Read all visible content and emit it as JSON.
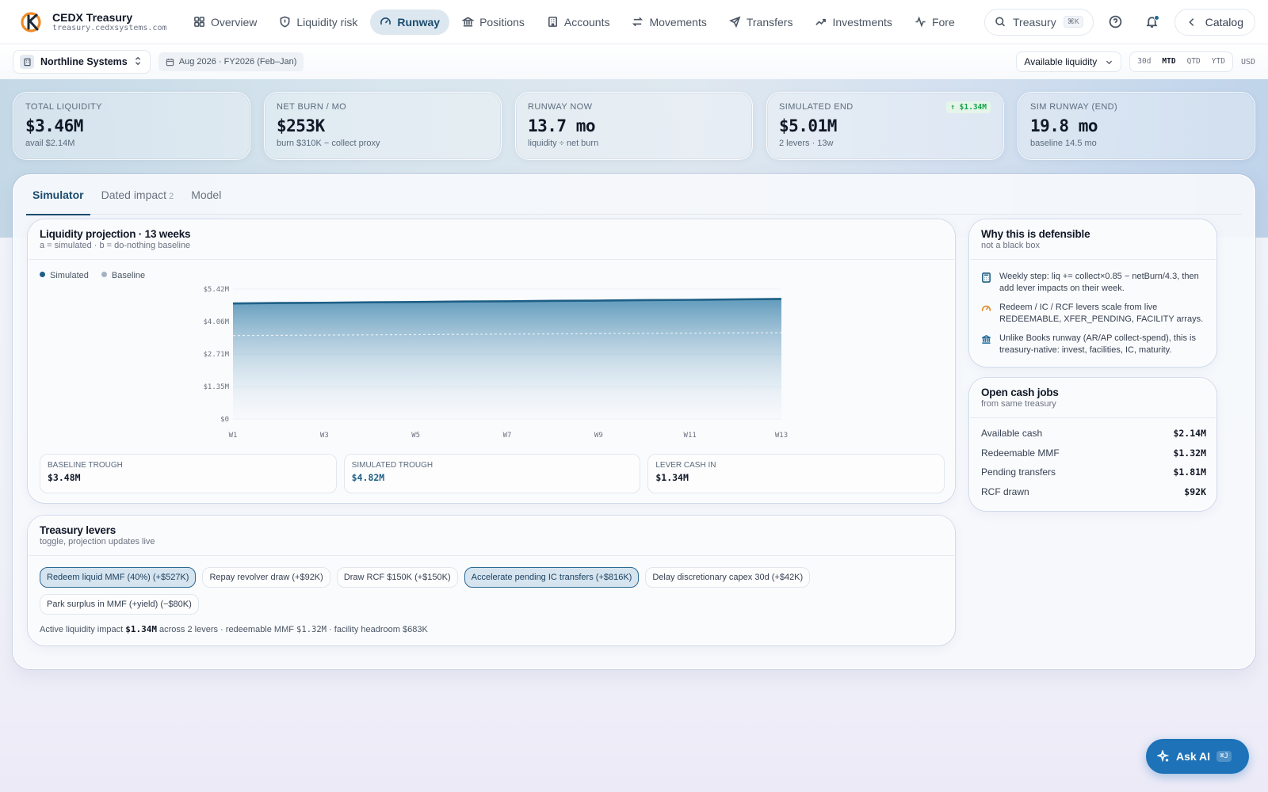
{
  "brand": {
    "title": "CEDX Treasury",
    "domain": "treasury.cedxsystems.com"
  },
  "nav": [
    {
      "label": "Overview",
      "icon": "grid-icon"
    },
    {
      "label": "Liquidity risk",
      "icon": "shield-icon"
    },
    {
      "label": "Runway",
      "icon": "gauge-icon",
      "active": true
    },
    {
      "label": "Positions",
      "icon": "bank-icon"
    },
    {
      "label": "Accounts",
      "icon": "building-icon"
    },
    {
      "label": "Movements",
      "icon": "arrows-icon"
    },
    {
      "label": "Transfers",
      "icon": "send-icon"
    },
    {
      "label": "Investments",
      "icon": "trend-icon"
    },
    {
      "label": "Fore",
      "icon": "pulse-icon"
    }
  ],
  "search": {
    "label": "Treasury",
    "shortcut": "⌘K"
  },
  "catalog_label": "Catalog",
  "subbar": {
    "org": "Northline Systems",
    "period": "Aug 2026 · FY2026 (Feb–Jan)",
    "liquidity_select": "Available liquidity",
    "ranges": [
      "30d",
      "MTD",
      "QTD",
      "YTD"
    ],
    "active_range": "MTD",
    "currency": "USD"
  },
  "kpis": [
    {
      "label": "Total liquidity",
      "value": "$3.46M",
      "sub": "avail $2.14M"
    },
    {
      "label": "Net burn / mo",
      "value": "$253K",
      "sub": "burn $310K − collect proxy"
    },
    {
      "label": "Runway now",
      "value": "13.7 mo",
      "sub": "liquidity ÷ net burn"
    },
    {
      "label": "Simulated end",
      "value": "$5.01M",
      "sub": "2 levers · 13w",
      "badge": "↑ $1.34M"
    },
    {
      "label": "Sim runway (end)",
      "value": "19.8 mo",
      "sub": "baseline 14.5 mo"
    }
  ],
  "tabs": [
    {
      "label": "Simulator",
      "active": true
    },
    {
      "label": "Dated impact",
      "count": "2"
    },
    {
      "label": "Model"
    }
  ],
  "projection": {
    "title": "Liquidity projection · 13 weeks",
    "subtitle": "a = simulated · b = do-nothing baseline",
    "legend": [
      "Simulated",
      "Baseline"
    ],
    "stats": [
      {
        "label": "Baseline trough",
        "value": "$3.48M"
      },
      {
        "label": "Simulated trough",
        "value": "$4.82M"
      },
      {
        "label": "Lever cash in",
        "value": "$1.34M"
      }
    ]
  },
  "chart_data": {
    "type": "area",
    "title": "Liquidity projection · 13 weeks",
    "x": [
      "W1",
      "W2",
      "W3",
      "W4",
      "W5",
      "W6",
      "W7",
      "W8",
      "W9",
      "W10",
      "W11",
      "W12",
      "W13"
    ],
    "x_tick_labels": [
      "W1",
      "W3",
      "W5",
      "W7",
      "W9",
      "W11",
      "W13"
    ],
    "y_ticks": [
      0,
      1.35,
      2.71,
      4.06,
      5.42
    ],
    "y_tick_labels": [
      "$0",
      "$1.35M",
      "$2.71M",
      "$4.06M",
      "$5.42M"
    ],
    "ylim": [
      0,
      5.42
    ],
    "series": [
      {
        "name": "Simulated",
        "values": [
          4.82,
          4.84,
          4.85,
          4.87,
          4.88,
          4.9,
          4.91,
          4.93,
          4.94,
          4.96,
          4.97,
          4.99,
          5.01
        ],
        "color": "#1e5f86"
      },
      {
        "name": "Baseline",
        "values": [
          3.48,
          3.49,
          3.5,
          3.51,
          3.52,
          3.53,
          3.54,
          3.55,
          3.56,
          3.57,
          3.58,
          3.59,
          3.6
        ],
        "color": "#c8d3de"
      }
    ],
    "grid": true,
    "legend": "top-left"
  },
  "levers": {
    "title": "Treasury levers",
    "subtitle": "toggle, projection updates live",
    "items": [
      {
        "label": "Redeem liquid MMF (40%) (+$527K)",
        "on": true
      },
      {
        "label": "Repay revolver draw (+$92K)",
        "on": false
      },
      {
        "label": "Draw RCF $150K (+$150K)",
        "on": false
      },
      {
        "label": "Accelerate pending IC transfers (+$816K)",
        "on": true
      },
      {
        "label": "Delay discretionary capex 30d (+$42K)",
        "on": false
      },
      {
        "label": "Park surplus in MMF (+yield) (−$80K)",
        "on": false
      }
    ],
    "footer": {
      "prefix": "Active liquidity impact",
      "impact": "$1.34M",
      "mid": "across 2 levers · redeemable MMF",
      "mmf": "$1.32M",
      "suffix": "· facility headroom $683K"
    }
  },
  "why": {
    "title": "Why this is defensible",
    "subtitle": "not a black box",
    "items": [
      {
        "text": "Weekly step: liq += collect×0.85 − netBurn/4.3, then add lever impacts on their week.",
        "icon": "calculator-icon",
        "color": "#1e5f86"
      },
      {
        "text": "Redeem / IC / RCF levers scale from live REDEEMABLE, XFER_PENDING, FACILITY arrays.",
        "icon": "gauge-icon",
        "color": "#e08a2a"
      },
      {
        "text": "Unlike Books runway (AR/AP collect-spend), this is treasury-native: invest, facilities, IC, maturity.",
        "icon": "bank-icon",
        "color": "#1e6b99"
      }
    ]
  },
  "jobs": {
    "title": "Open cash jobs",
    "subtitle": "from same treasury",
    "rows": [
      {
        "label": "Available cash",
        "value": "$2.14M"
      },
      {
        "label": "Redeemable MMF",
        "value": "$1.32M"
      },
      {
        "label": "Pending transfers",
        "value": "$1.81M"
      },
      {
        "label": "RCF drawn",
        "value": "$92K"
      }
    ]
  },
  "ask_ai": {
    "label": "Ask AI",
    "shortcut": "⌘J"
  }
}
